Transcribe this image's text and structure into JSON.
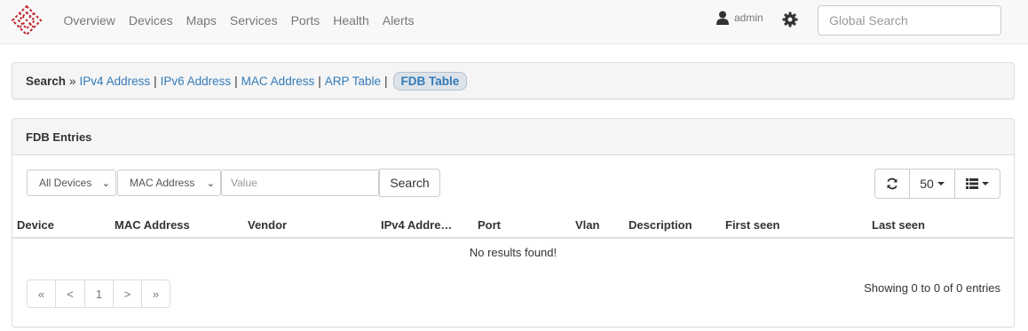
{
  "nav": {
    "items": [
      "Overview",
      "Devices",
      "Maps",
      "Services",
      "Ports",
      "Health",
      "Alerts"
    ],
    "user": "admin",
    "search_placeholder": "Global Search"
  },
  "breadcrumb": {
    "title": "Search",
    "separator": "»",
    "links": [
      "IPv4 Address",
      "IPv6 Address",
      "MAC Address",
      "ARP Table"
    ],
    "active": "FDB Table"
  },
  "fdb": {
    "title": "FDB Entries",
    "device_select": "All Devices",
    "field_select": "MAC Address",
    "value_placeholder": "Value",
    "search_button": "Search",
    "page_size": "50",
    "columns": [
      "Device",
      "MAC Address",
      "Vendor",
      "IPv4 Addre…",
      "Port",
      "Vlan",
      "Description",
      "First seen",
      "Last seen"
    ],
    "no_results": "No results found!",
    "pagination": [
      "«",
      "<",
      "1",
      ">",
      "»"
    ],
    "showing": "Showing 0 to 0 of 0 entries"
  },
  "colors": {
    "link": "#337ab7",
    "nav_text": "#777777",
    "logo_red": "#c3272f"
  }
}
